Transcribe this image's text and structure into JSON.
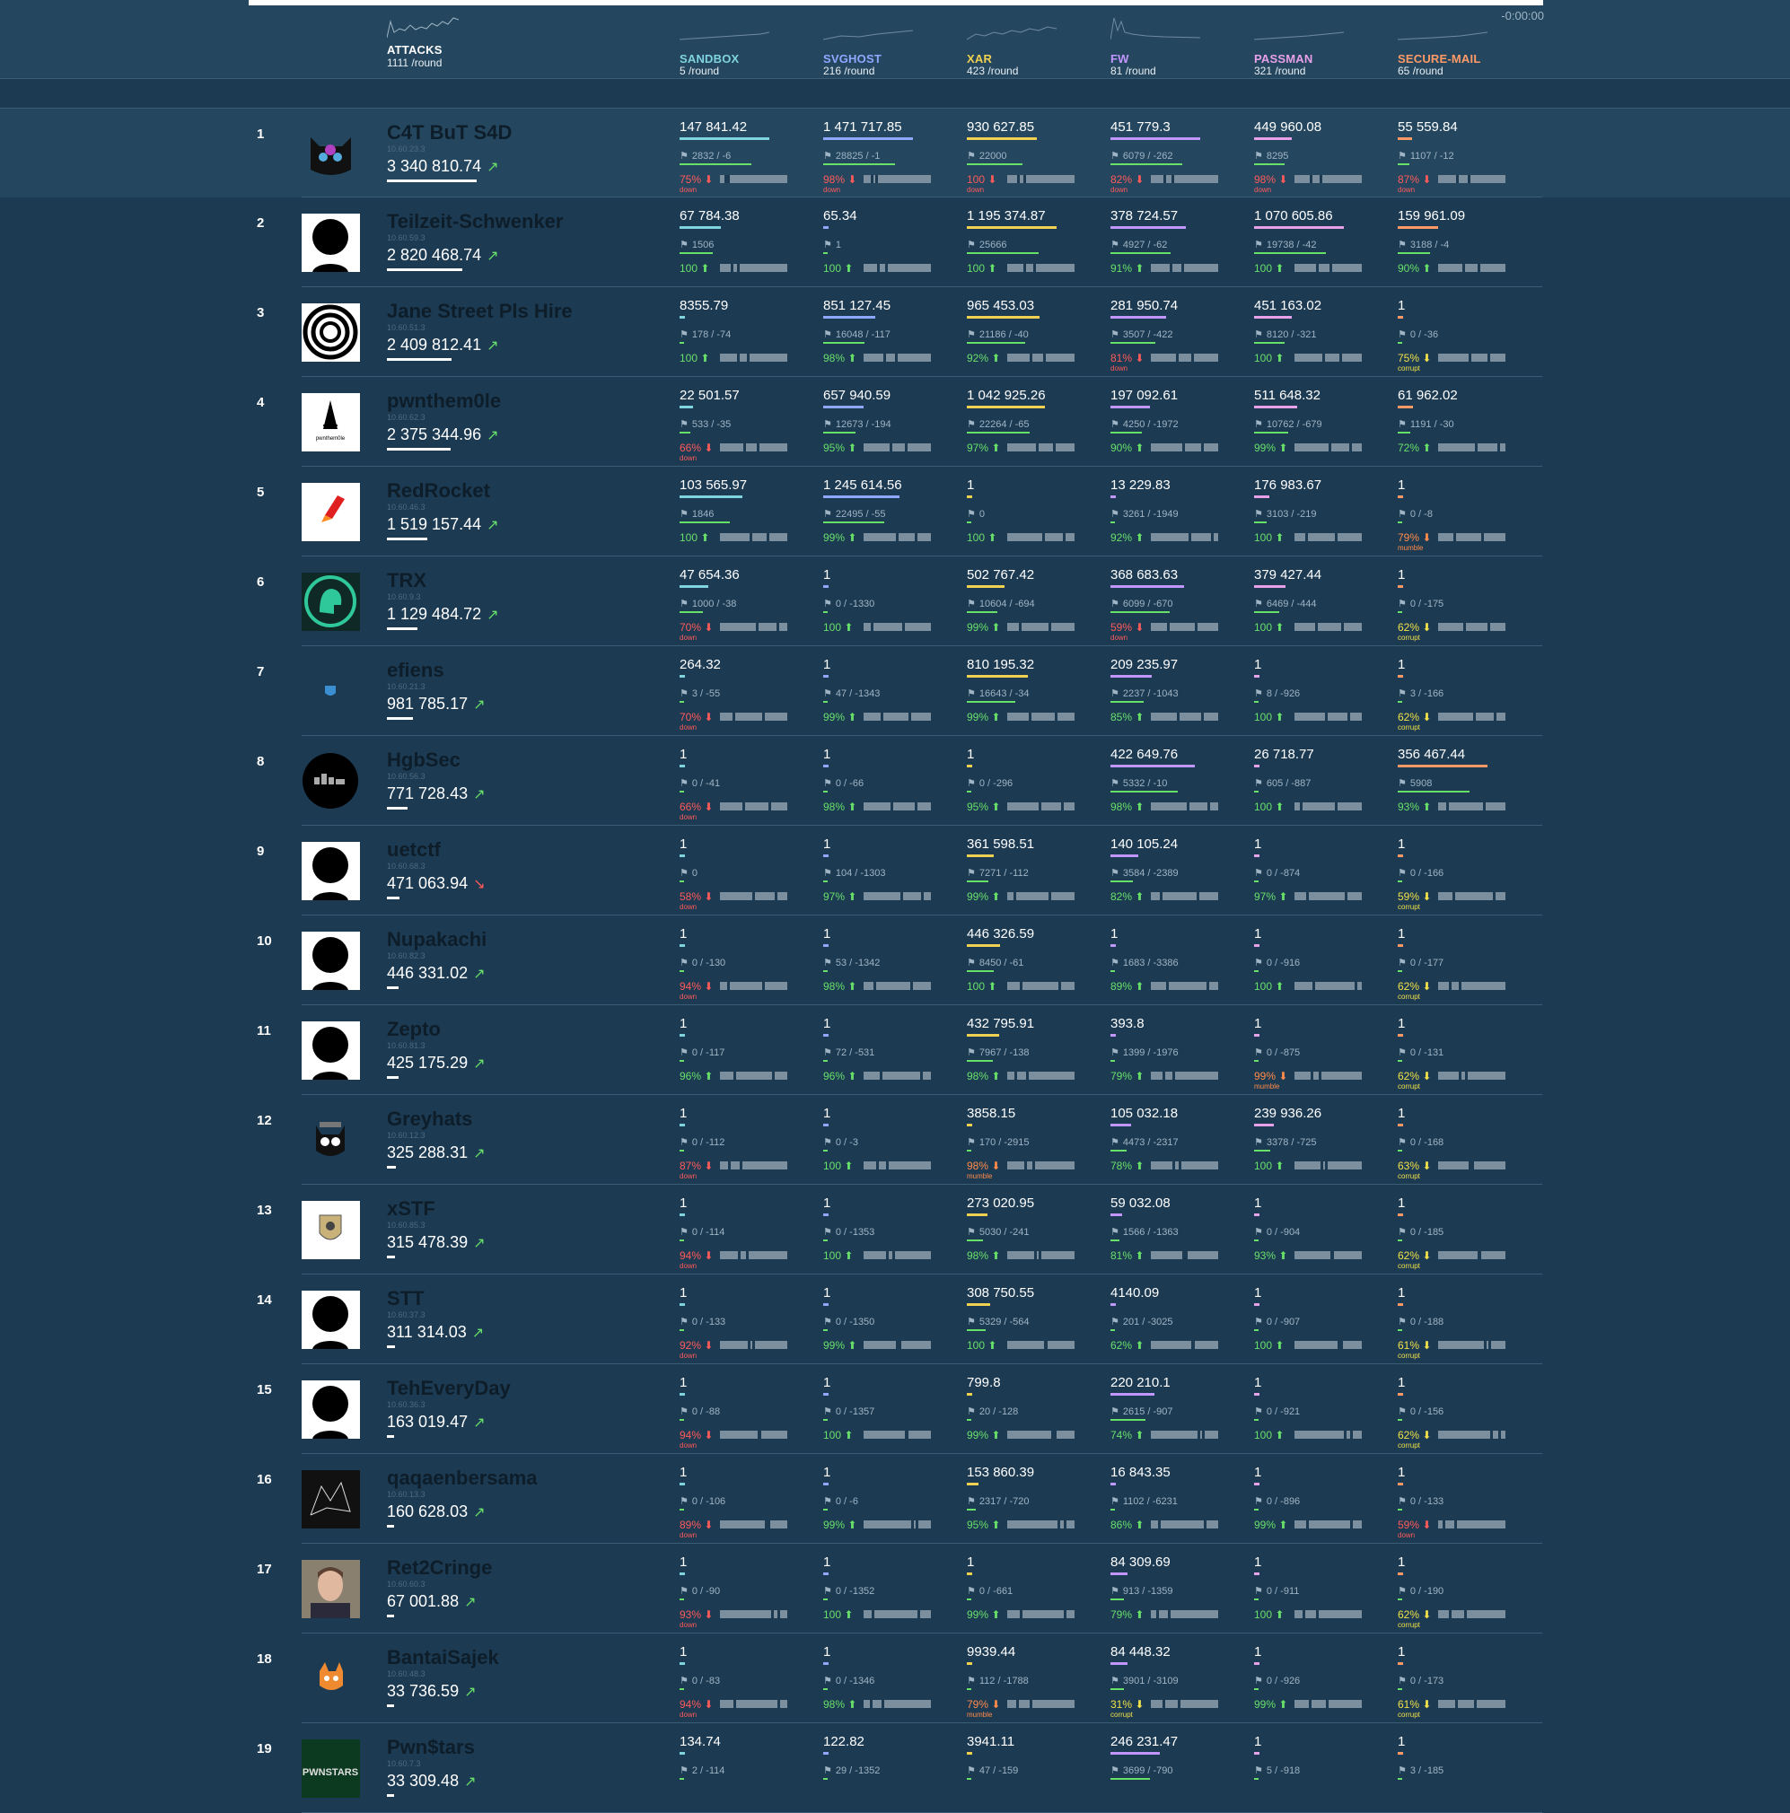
{
  "timer": "-0:00:00",
  "attacks": {
    "name": "ATTACKS",
    "rate": "1111",
    "unit": "/round"
  },
  "services": [
    {
      "name": "SANDBOX",
      "rate": "5",
      "unit": "/round",
      "color": "#7fd4e0"
    },
    {
      "name": "SVGHOST",
      "rate": "216",
      "unit": "/round",
      "color": "#8fa8ff"
    },
    {
      "name": "XAR",
      "rate": "423",
      "unit": "/round",
      "color": "#f0d050"
    },
    {
      "name": "FW",
      "rate": "81",
      "unit": "/round",
      "color": "#c296ff"
    },
    {
      "name": "PASSMAN",
      "rate": "321",
      "unit": "/round",
      "color": "#e8a0e8"
    },
    {
      "name": "SECURE-MAIL",
      "rate": "65",
      "unit": "/round",
      "color": "#ff9a66"
    }
  ],
  "teams": [
    {
      "rank": "1",
      "name": "C4T BuT S4D",
      "ip": "10.60.23.3",
      "score": "3 340 810.74",
      "trend": "up",
      "avatar": "cat-avatar",
      "cells": [
        {
          "v": "147 841.42",
          "f": "2832 / -6",
          "s": "75%",
          "st": "down"
        },
        {
          "v": "1 471 717.85",
          "f": "28825 / -1",
          "s": "98%",
          "st": "down"
        },
        {
          "v": "930 627.85",
          "f": "22000",
          "s": "100",
          "st": "down"
        },
        {
          "v": "451 779.3",
          "f": "6079 / -262",
          "s": "82%",
          "st": "down"
        },
        {
          "v": "449 960.08",
          "f": "8295",
          "s": "98%",
          "st": "down"
        },
        {
          "v": "55 559.84",
          "f": "1107 / -12",
          "s": "87%",
          "st": "down"
        }
      ]
    },
    {
      "rank": "2",
      "name": "Teilzeit-Schwenker",
      "ip": "10.60.59.3",
      "score": "2 820 468.74",
      "trend": "up",
      "avatar": "default-avatar",
      "cells": [
        {
          "v": "67 784.38",
          "f": "1506",
          "s": "100",
          "st": "up"
        },
        {
          "v": "65.34",
          "f": "1",
          "s": "100",
          "st": "up"
        },
        {
          "v": "1 195 374.87",
          "f": "25666",
          "s": "100",
          "st": "up"
        },
        {
          "v": "378 724.57",
          "f": "4927 / -62",
          "s": "91%",
          "st": "up"
        },
        {
          "v": "1 070 605.86",
          "f": "19738 / -42",
          "s": "100",
          "st": "up"
        },
        {
          "v": "159 961.09",
          "f": "3188 / -4",
          "s": "90%",
          "st": "up"
        }
      ]
    },
    {
      "rank": "3",
      "name": "Jane Street Pls Hire",
      "ip": "10.60.51.3",
      "score": "2 409 812.41",
      "trend": "up",
      "avatar": "rings-avatar",
      "cells": [
        {
          "v": "8355.79",
          "f": "178 / -74",
          "s": "100",
          "st": "up"
        },
        {
          "v": "851 127.45",
          "f": "16048 / -117",
          "s": "98%",
          "st": "up"
        },
        {
          "v": "965 453.03",
          "f": "21186 / -40",
          "s": "92%",
          "st": "up"
        },
        {
          "v": "281 950.74",
          "f": "3507 / -422",
          "s": "81%",
          "st": "down"
        },
        {
          "v": "451 163.02",
          "f": "8120 / -321",
          "s": "100",
          "st": "up"
        },
        {
          "v": "1",
          "f": "0 / -36",
          "s": "75%",
          "st": "corrupt"
        }
      ]
    },
    {
      "rank": "4",
      "name": "pwnthem0le",
      "ip": "10.60.62.3",
      "score": "2 375 344.96",
      "trend": "up",
      "avatar": "pwnthem0le-avatar",
      "cells": [
        {
          "v": "22 501.57",
          "f": "533 / -35",
          "s": "66%",
          "st": "down"
        },
        {
          "v": "657 940.59",
          "f": "12673 / -194",
          "s": "95%",
          "st": "up"
        },
        {
          "v": "1 042 925.26",
          "f": "22264 / -65",
          "s": "97%",
          "st": "up"
        },
        {
          "v": "197 092.61",
          "f": "4250 / -1972",
          "s": "90%",
          "st": "up"
        },
        {
          "v": "511 648.32",
          "f": "10762 / -679",
          "s": "99%",
          "st": "up"
        },
        {
          "v": "61 962.02",
          "f": "1191 / -30",
          "s": "72%",
          "st": "up"
        }
      ]
    },
    {
      "rank": "5",
      "name": "RedRocket",
      "ip": "10.60.46.3",
      "score": "1 519 157.44",
      "trend": "up",
      "avatar": "rocket-avatar",
      "cells": [
        {
          "v": "103 565.97",
          "f": "1846",
          "s": "100",
          "st": "up"
        },
        {
          "v": "1 245 614.56",
          "f": "22495 / -55",
          "s": "99%",
          "st": "up"
        },
        {
          "v": "1",
          "f": "0",
          "s": "100",
          "st": "up"
        },
        {
          "v": "13 229.83",
          "f": "3261 / -1949",
          "s": "92%",
          "st": "up"
        },
        {
          "v": "176 983.67",
          "f": "3103 / -219",
          "s": "100",
          "st": "up"
        },
        {
          "v": "1",
          "f": "0 / -8",
          "s": "79%",
          "st": "mumble"
        }
      ]
    },
    {
      "rank": "6",
      "name": "TRX",
      "ip": "10.60.9.3",
      "score": "1 129 484.72",
      "trend": "up",
      "avatar": "helmet-avatar",
      "cells": [
        {
          "v": "47 654.36",
          "f": "1000 / -38",
          "s": "70%",
          "st": "down"
        },
        {
          "v": "1",
          "f": "0 / -1330",
          "s": "100",
          "st": "up"
        },
        {
          "v": "502 767.42",
          "f": "10604 / -694",
          "s": "99%",
          "st": "up"
        },
        {
          "v": "368 683.63",
          "f": "6099 / -670",
          "s": "59%",
          "st": "down"
        },
        {
          "v": "379 427.44",
          "f": "6469 / -444",
          "s": "100",
          "st": "up"
        },
        {
          "v": "1",
          "f": "0 / -175",
          "s": "62%",
          "st": "corrupt"
        }
      ]
    },
    {
      "rank": "7",
      "name": "efiens",
      "ip": "10.60.21.3",
      "score": "981 785.17",
      "trend": "up",
      "avatar": "shield-avatar",
      "cells": [
        {
          "v": "264.32",
          "f": "3 / -55",
          "s": "70%",
          "st": "down"
        },
        {
          "v": "1",
          "f": "47 / -1343",
          "s": "99%",
          "st": "up"
        },
        {
          "v": "810 195.32",
          "f": "16643 / -34",
          "s": "99%",
          "st": "up"
        },
        {
          "v": "209 235.97",
          "f": "2237 / -1043",
          "s": "85%",
          "st": "up"
        },
        {
          "v": "1",
          "f": "8 / -926",
          "s": "100",
          "st": "up"
        },
        {
          "v": "1",
          "f": "3 / -166",
          "s": "62%",
          "st": "corrupt"
        }
      ]
    },
    {
      "rank": "8",
      "name": "HgbSec",
      "ip": "10.60.56.3",
      "score": "771 728.43",
      "trend": "up",
      "avatar": "hgb-avatar",
      "cells": [
        {
          "v": "1",
          "f": "0 / -41",
          "s": "66%",
          "st": "down"
        },
        {
          "v": "1",
          "f": "0 / -66",
          "s": "98%",
          "st": "up"
        },
        {
          "v": "1",
          "f": "0 / -296",
          "s": "95%",
          "st": "up"
        },
        {
          "v": "422 649.76",
          "f": "5332 / -10",
          "s": "98%",
          "st": "up"
        },
        {
          "v": "26 718.77",
          "f": "605 / -887",
          "s": "100",
          "st": "up"
        },
        {
          "v": "356 467.44",
          "f": "5908",
          "s": "93%",
          "st": "up"
        }
      ]
    },
    {
      "rank": "9",
      "name": "uetctf",
      "ip": "10.60.68.3",
      "score": "471 063.94",
      "trend": "down",
      "avatar": "default-avatar",
      "cells": [
        {
          "v": "1",
          "f": "0",
          "s": "58%",
          "st": "down"
        },
        {
          "v": "1",
          "f": "104 / -1303",
          "s": "97%",
          "st": "up"
        },
        {
          "v": "361 598.51",
          "f": "7271 / -112",
          "s": "99%",
          "st": "up"
        },
        {
          "v": "140 105.24",
          "f": "3584 / -2389",
          "s": "82%",
          "st": "up"
        },
        {
          "v": "1",
          "f": "0 / -874",
          "s": "97%",
          "st": "up"
        },
        {
          "v": "1",
          "f": "0 / -166",
          "s": "59%",
          "st": "corrupt"
        }
      ]
    },
    {
      "rank": "10",
      "name": "Nupakachi",
      "ip": "10.60.82.3",
      "score": "446 331.02",
      "trend": "up",
      "avatar": "default-avatar",
      "cells": [
        {
          "v": "1",
          "f": "0 / -130",
          "s": "94%",
          "st": "down"
        },
        {
          "v": "1",
          "f": "53 / -1342",
          "s": "98%",
          "st": "up"
        },
        {
          "v": "446 326.59",
          "f": "8450 / -61",
          "s": "100",
          "st": "up"
        },
        {
          "v": "1",
          "f": "1683 / -3386",
          "s": "89%",
          "st": "up"
        },
        {
          "v": "1",
          "f": "0 / -916",
          "s": "100",
          "st": "up"
        },
        {
          "v": "1",
          "f": "0 / -177",
          "s": "62%",
          "st": "corrupt"
        }
      ]
    },
    {
      "rank": "11",
      "name": "Zepto",
      "ip": "10.60.81.3",
      "score": "425 175.29",
      "trend": "up",
      "avatar": "default-avatar",
      "cells": [
        {
          "v": "1",
          "f": "0 / -117",
          "s": "96%",
          "st": "up"
        },
        {
          "v": "1",
          "f": "72 / -531",
          "s": "96%",
          "st": "up"
        },
        {
          "v": "432 795.91",
          "f": "7967 / -138",
          "s": "98%",
          "st": "up"
        },
        {
          "v": "393.8",
          "f": "1399 / -1976",
          "s": "79%",
          "st": "up"
        },
        {
          "v": "1",
          "f": "0 / -875",
          "s": "99%",
          "st": "mumble"
        },
        {
          "v": "1",
          "f": "0 / -131",
          "s": "62%",
          "st": "corrupt"
        }
      ]
    },
    {
      "rank": "12",
      "name": "Greyhats",
      "ip": "10.60.12.3",
      "score": "325 288.31",
      "trend": "up",
      "avatar": "greycat-avatar",
      "cells": [
        {
          "v": "1",
          "f": "0 / -112",
          "s": "87%",
          "st": "down"
        },
        {
          "v": "1",
          "f": "0 / -3",
          "s": "100",
          "st": "up"
        },
        {
          "v": "3858.15",
          "f": "170 / -2915",
          "s": "98%",
          "st": "mumble"
        },
        {
          "v": "105 032.18",
          "f": "4473 / -2317",
          "s": "78%",
          "st": "up"
        },
        {
          "v": "239 936.26",
          "f": "3378 / -725",
          "s": "100",
          "st": "up"
        },
        {
          "v": "1",
          "f": "0 / -168",
          "s": "63%",
          "st": "corrupt"
        }
      ]
    },
    {
      "rank": "13",
      "name": "xSTF",
      "ip": "10.60.85.3",
      "score": "315 478.39",
      "trend": "up",
      "avatar": "emblem-avatar",
      "cells": [
        {
          "v": "1",
          "f": "0 / -114",
          "s": "94%",
          "st": "down"
        },
        {
          "v": "1",
          "f": "0 / -1353",
          "s": "100",
          "st": "up"
        },
        {
          "v": "273 020.95",
          "f": "5030 / -241",
          "s": "98%",
          "st": "up"
        },
        {
          "v": "59 032.08",
          "f": "1566 / -1363",
          "s": "81%",
          "st": "up"
        },
        {
          "v": "1",
          "f": "0 / -904",
          "s": "93%",
          "st": "up"
        },
        {
          "v": "1",
          "f": "0 / -185",
          "s": "62%",
          "st": "corrupt"
        }
      ]
    },
    {
      "rank": "14",
      "name": "STT",
      "ip": "10.60.37.3",
      "score": "311 314.03",
      "trend": "up",
      "avatar": "default-avatar",
      "cells": [
        {
          "v": "1",
          "f": "0 / -133",
          "s": "92%",
          "st": "down"
        },
        {
          "v": "1",
          "f": "0 / -1350",
          "s": "99%",
          "st": "up"
        },
        {
          "v": "308 750.55",
          "f": "5329 / -564",
          "s": "100",
          "st": "up"
        },
        {
          "v": "4140.09",
          "f": "201 / -3025",
          "s": "62%",
          "st": "up"
        },
        {
          "v": "1",
          "f": "0 / -907",
          "s": "100",
          "st": "up"
        },
        {
          "v": "1",
          "f": "0 / -188",
          "s": "61%",
          "st": "corrupt"
        }
      ]
    },
    {
      "rank": "15",
      "name": "TehEveryDay",
      "ip": "10.60.36.3",
      "score": "163 019.47",
      "trend": "up",
      "avatar": "default-avatar",
      "cells": [
        {
          "v": "1",
          "f": "0 / -88",
          "s": "94%",
          "st": "down"
        },
        {
          "v": "1",
          "f": "0 / -1357",
          "s": "100",
          "st": "up"
        },
        {
          "v": "799.8",
          "f": "20 / -128",
          "s": "99%",
          "st": "up"
        },
        {
          "v": "220 210.1",
          "f": "2615 / -907",
          "s": "74%",
          "st": "up"
        },
        {
          "v": "1",
          "f": "0 / -921",
          "s": "100",
          "st": "up"
        },
        {
          "v": "1",
          "f": "0 / -156",
          "s": "62%",
          "st": "corrupt"
        }
      ]
    },
    {
      "rank": "16",
      "name": "qaqaenbersama",
      "ip": "10.60.13.3",
      "score": "160 628.03",
      "trend": "up",
      "avatar": "sketch-avatar",
      "cells": [
        {
          "v": "1",
          "f": "0 / -106",
          "s": "89%",
          "st": "down"
        },
        {
          "v": "1",
          "f": "0 / -6",
          "s": "99%",
          "st": "up"
        },
        {
          "v": "153 860.39",
          "f": "2317 / -720",
          "s": "95%",
          "st": "up"
        },
        {
          "v": "16 843.35",
          "f": "1102 / -6231",
          "s": "86%",
          "st": "up"
        },
        {
          "v": "1",
          "f": "0 / -896",
          "s": "99%",
          "st": "up"
        },
        {
          "v": "1",
          "f": "0 / -133",
          "s": "59%",
          "st": "down"
        }
      ]
    },
    {
      "rank": "17",
      "name": "Ret2Cringe",
      "ip": "10.60.60.3",
      "score": "67 001.88",
      "trend": "up",
      "avatar": "photo-avatar",
      "cells": [
        {
          "v": "1",
          "f": "0 / -90",
          "s": "93%",
          "st": "down"
        },
        {
          "v": "1",
          "f": "0 / -1352",
          "s": "100",
          "st": "up"
        },
        {
          "v": "1",
          "f": "0 / -661",
          "s": "99%",
          "st": "up"
        },
        {
          "v": "84 309.69",
          "f": "913 / -1359",
          "s": "79%",
          "st": "up"
        },
        {
          "v": "1",
          "f": "0 / -911",
          "s": "100",
          "st": "up"
        },
        {
          "v": "1",
          "f": "0 / -190",
          "s": "62%",
          "st": "corrupt"
        }
      ]
    },
    {
      "rank": "18",
      "name": "BantaiSajek",
      "ip": "10.60.48.3",
      "score": "33 736.59",
      "trend": "up",
      "avatar": "fox-avatar",
      "cells": [
        {
          "v": "1",
          "f": "0 / -83",
          "s": "94%",
          "st": "down"
        },
        {
          "v": "1",
          "f": "0 / -1346",
          "s": "98%",
          "st": "up"
        },
        {
          "v": "9939.44",
          "f": "112 / -1788",
          "s": "79%",
          "st": "mumble"
        },
        {
          "v": "84 448.32",
          "f": "3901 / -3109",
          "s": "31%",
          "st": "corrupt"
        },
        {
          "v": "1",
          "f": "0 / -926",
          "s": "99%",
          "st": "up"
        },
        {
          "v": "1",
          "f": "0 / -173",
          "s": "61%",
          "st": "corrupt"
        }
      ]
    },
    {
      "rank": "19",
      "name": "Pwn$tars",
      "ip": "10.60.7.3",
      "score": "33 309.48",
      "trend": "up",
      "avatar": "pwnstars-avatar",
      "cells": [
        {
          "v": "134.74",
          "f": "2 / -114",
          "s": "",
          "st": "up"
        },
        {
          "v": "122.82",
          "f": "29 / -1352",
          "s": "",
          "st": "up"
        },
        {
          "v": "3941.11",
          "f": "47 / -159",
          "s": "",
          "st": "up"
        },
        {
          "v": "246 231.47",
          "f": "3699 / -790",
          "s": "",
          "st": "up"
        },
        {
          "v": "1",
          "f": "5 / -918",
          "s": "",
          "st": "up"
        },
        {
          "v": "1",
          "f": "3 / -185",
          "s": "",
          "st": "up"
        }
      ]
    }
  ]
}
